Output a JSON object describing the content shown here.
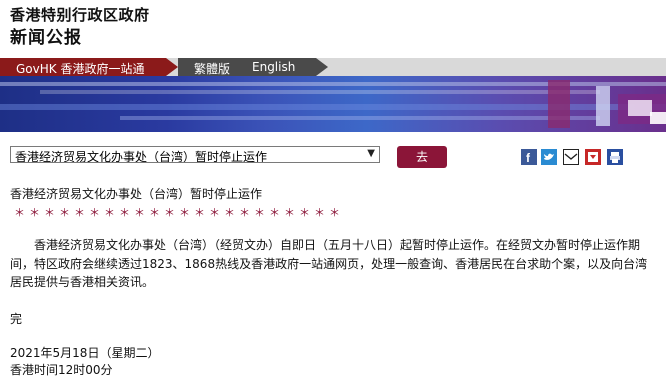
{
  "header": {
    "org_name": "香港特别行政区政府",
    "section_title": "新闻公报"
  },
  "nav": {
    "govhk": "GovHK 香港政府一站通",
    "traditional": "繁體版",
    "english": "English"
  },
  "controls": {
    "select_value": "香港经济贸易文化办事处（台湾）暂时停止运作",
    "go_label": "去"
  },
  "share_icons": [
    "facebook-icon",
    "twitter-icon",
    "email-icon",
    "bookmark-icon",
    "print-icon"
  ],
  "colors": {
    "brand_maroon": "#8b1538",
    "govhk_red": "#8b1a1a",
    "banner_blue": "#2a3aa0"
  },
  "article": {
    "title": "香港经济贸易文化办事处（台湾）暂时停止运作",
    "stars": "＊＊＊＊＊＊＊＊＊＊＊＊＊＊＊＊＊＊＊＊＊＊",
    "body": "香港经济贸易文化办事处（台湾）（经贸文办）自即日（五月十八日）起暂时停止运作。在经贸文办暂时停止运作期间，特区政府会继续透过1823、1868热线及香港政府一站通网页，处理一般查询、香港居民在台求助个案，以及向台湾居民提供与香港相关资讯。",
    "end_mark": "完",
    "date": "2021年5月18日（星期二）",
    "time": "香港时间12时00分"
  }
}
